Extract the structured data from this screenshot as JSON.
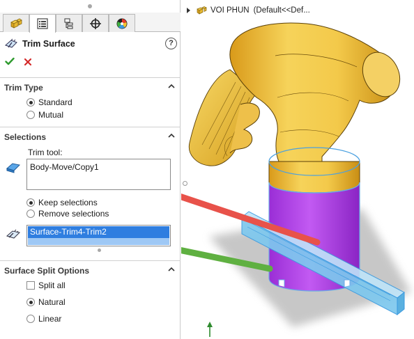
{
  "feature": {
    "title": "Trim Surface",
    "help_symbol": "?"
  },
  "tabs": [
    {
      "name": "feature-manager",
      "icon": "part-cubes-icon"
    },
    {
      "name": "property-manager",
      "icon": "property-list-icon"
    },
    {
      "name": "configuration-manager",
      "icon": "configuration-icon"
    },
    {
      "name": "dimxpert-manager",
      "icon": "crosshair-icon"
    },
    {
      "name": "display-manager",
      "icon": "color-wheel-icon"
    }
  ],
  "trim_type": {
    "heading": "Trim Type",
    "options": [
      "Standard",
      "Mutual"
    ],
    "selected": "Standard"
  },
  "selections": {
    "heading": "Selections",
    "trim_tool_label": "Trim tool:",
    "trim_tool_value": "Body-Move/Copy1",
    "keep_label": "Keep selections",
    "remove_label": "Remove selections",
    "keep_mode": "Keep selections",
    "pieces_value": "Surface-Trim4-Trim2"
  },
  "split_options": {
    "heading": "Surface Split Options",
    "split_all_label": "Split all",
    "split_all_checked": false,
    "natural_label": "Natural",
    "linear_label": "Linear",
    "selected": "Natural"
  },
  "tree": {
    "part_name": "VOI PHUN",
    "config": "(Default<<Def..."
  },
  "colors": {
    "body_yellow": "#f2c84b",
    "trim_purple": "#b43fe8",
    "surface_blue": "#7ec8ee",
    "arrow_red": "#e8524a",
    "arrow_green": "#5fb041",
    "ok_green": "#2e9a2e",
    "cancel_red": "#d42a2a",
    "selection_blue": "#2f7ee0"
  }
}
